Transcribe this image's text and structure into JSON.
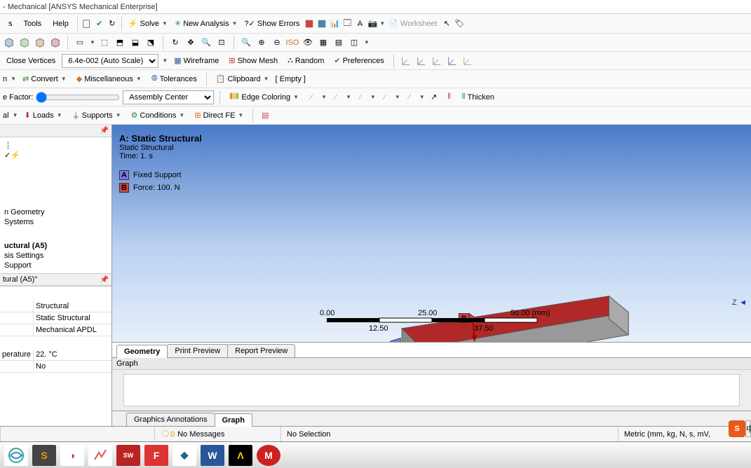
{
  "window": {
    "title": "- Mechanical [ANSYS Mechanical Enterprise]"
  },
  "menu": {
    "tools": "Tools",
    "help": "Help"
  },
  "toolbar1": {
    "solve": "Solve",
    "new_analysis": "New Analysis",
    "show_errors": "Show Errors",
    "worksheet": "Worksheet"
  },
  "toolbar2": {
    "close_vertices": "Close Vertices",
    "scale": "6.4e-002 (Auto Scale)",
    "wireframe": "Wireframe",
    "show_mesh": "Show Mesh",
    "random": "Random",
    "preferences": "Preferences"
  },
  "toolbar3": {
    "convert": "Convert",
    "miscellaneous": "Miscellaneous",
    "tolerances": "Tolerances",
    "clipboard": "Clipboard",
    "empty": "[ Empty ]"
  },
  "toolbar4": {
    "factor": "e Factor:",
    "assembly_center": "Assembly Center",
    "edge_coloring": "Edge Coloring",
    "thicken": "Thicken"
  },
  "toolbar5": {
    "al": "al",
    "loads": "Loads",
    "supports": "Supports",
    "conditions": "Conditions",
    "direct_fe": "Direct FE"
  },
  "tree": {
    "geometry": "n Geometry",
    "systems": "Systems",
    "structural": "uctural (A5)",
    "analysis_settings": "sis Settings",
    "fixed_support": "Support"
  },
  "details": {
    "title": "tural (A5)\"",
    "rows": [
      {
        "key": "",
        "val": "Structural"
      },
      {
        "key": "",
        "val": "Static Structural"
      },
      {
        "key": "",
        "val": "Mechanical APDL"
      }
    ],
    "temp_key": "perature",
    "temp_val": "22. °C",
    "no_key": "",
    "no_val": "No"
  },
  "viewport": {
    "title": "A: Static Structural",
    "subtitle": "Static Structural",
    "time": "Time: 1. s",
    "legend_a": "Fixed Support",
    "legend_b": "Force: 100. N",
    "tag_a": "A",
    "tag_b": "B",
    "axis_z": "Z",
    "scale": {
      "v0": "0.00",
      "v1": "12.50",
      "v2": "25.00",
      "v3": "37.50",
      "v4": "50.00 (mm)"
    }
  },
  "view_tabs": {
    "geometry": "Geometry",
    "print_preview": "Print Preview",
    "report_preview": "Report Preview"
  },
  "graph": {
    "title": "Graph"
  },
  "bottom_tabs": {
    "annotations": "Graphics Annotations",
    "graph": "Graph"
  },
  "status": {
    "messages": "No Messages",
    "selection": "No Selection",
    "units": "Metric (mm, kg, N, s, mV,"
  },
  "badge": "S",
  "badge2": "中"
}
